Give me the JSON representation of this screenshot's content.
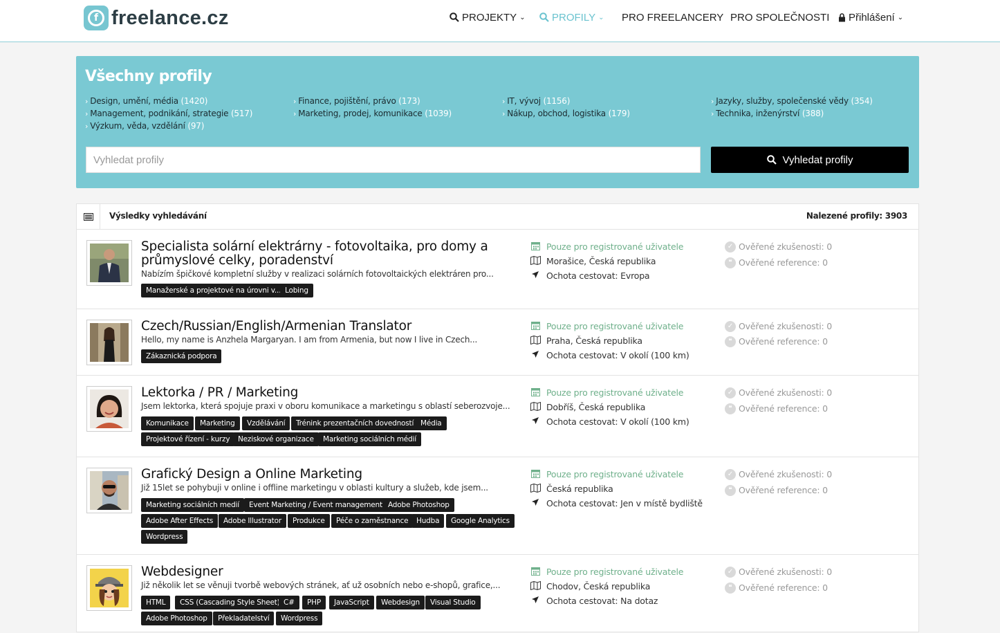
{
  "header": {
    "logo_text": "freelance.cz",
    "nav": [
      {
        "label": "PROJEKTY",
        "icon": "search-icon",
        "active": false
      },
      {
        "label": "PROFILY",
        "icon": "search-icon",
        "active": true
      },
      {
        "label": "PRO FREELANCERY"
      },
      {
        "label": "PRO SPOLEČNOSTI"
      },
      {
        "label": "Přihlášení",
        "icon": "lock-icon"
      }
    ],
    "accent_color": "#7ac9d3"
  },
  "hero": {
    "title": "Všechny profily",
    "categories": [
      {
        "label": "Design, umění, média",
        "count": "(1420)"
      },
      {
        "label": "Finance, pojištění, právo",
        "count": "(173)"
      },
      {
        "label": "IT, vývoj",
        "count": "(1156)"
      },
      {
        "label": "Jazyky, služby, společenské vědy",
        "count": "(354)"
      },
      {
        "label": "Management, podnikání, strategie",
        "count": "(517)"
      },
      {
        "label": "Marketing, prodej, komunikace",
        "count": "(1039)"
      },
      {
        "label": "Nákup, obchod, logistika",
        "count": "(179)"
      },
      {
        "label": "Technika, inženýrství",
        "count": "(388)"
      },
      {
        "label": "Výzkum, věda, vzdělání",
        "count": "(97)"
      }
    ],
    "search_placeholder": "Vyhledat profily",
    "search_button": "Vyhledat profily"
  },
  "results": {
    "title": "Výsledky vyhledávání",
    "count_label": "Nalezené profily: 3903",
    "profiles": [
      {
        "title": "Specialista solární elektrárny - fotovoltaika, pro domy a průmyslové celky, poradenství",
        "desc": "Nabízím špičkové kompletní služby v realizaci solárních fotovoltaických elektráren pro...",
        "tags": [
          "Manažerské a projektové na úrovni v...",
          "Lobing"
        ],
        "availability": "Pouze pro registrované uživatele",
        "location": "Morašice, Česká republika",
        "travel": "Ochota cestovat: Evropa",
        "verified_exp": "Ověřené zkušenosti: 0",
        "verified_ref": "Ověřené reference: 0"
      },
      {
        "title": "Czech/Russian/English/Armenian Translator",
        "desc": "Hello, my name is Anzhela Margaryan. I am from Armenia, but now I live in Czech...",
        "tags": [
          "Zákaznická podpora"
        ],
        "availability": "Pouze pro registrované uživatele",
        "location": "Praha, Česká republika",
        "travel": "Ochota cestovat: V okolí (100 km)",
        "verified_exp": "Ověřené zkušenosti: 0",
        "verified_ref": "Ověřené reference: 0"
      },
      {
        "title": "Lektorka / PR / Marketing",
        "desc": "Jsem lektorka, která spojuje praxi v oboru komunikace a marketingu s oblastí seberozvoje...",
        "tags": [
          "Komunikace",
          "Marketing",
          "Vzdělávání",
          "Trénink prezentačních dovedností",
          "Média",
          "Projektové řízení - kurzy",
          "Neziskové organizace",
          "Marketing sociálních médií"
        ],
        "availability": "Pouze pro registrované uživatele",
        "location": "Dobříš, Česká republika",
        "travel": "Ochota cestovat: V okolí (100 km)",
        "verified_exp": "Ověřené zkušenosti: 0",
        "verified_ref": "Ověřené reference: 0"
      },
      {
        "title": "Grafický Design a Online Marketing",
        "desc": "Již 15let se pohybuji v online i offline marketingu v oblasti kultury a služeb, kde jsem...",
        "tags": [
          "Marketing sociálních medií",
          "Event Marketing / Event management",
          "Adobe Photoshop",
          "Adobe After Effects",
          "Adobe Illustrator",
          "Produkce",
          "Péče o zaměstnance",
          "Hudba",
          "Google Analytics",
          "Wordpress"
        ],
        "availability": "Pouze pro registrované uživatele",
        "location": "Česká republika",
        "travel": "Ochota cestovat: Jen v místě bydliště",
        "verified_exp": "Ověřené zkušenosti: 0",
        "verified_ref": "Ověřené reference: 0"
      },
      {
        "title": "Webdesigner",
        "desc": "Již několik let se věnuji tvorbě webových stránek, ať už osobních nebo e-shopů, grafice,...",
        "tags": [
          "HTML",
          "CSS (Cascading Style Sheet)",
          "C#",
          "PHP",
          "JavaScript",
          "Webdesign",
          "Visual Studio",
          "Adobe Photoshop",
          "Překladatelství",
          "Wordpress"
        ],
        "availability": "Pouze pro registrované uživatele",
        "location": "Chodov, Česká republika",
        "travel": "Ochota cestovat: Na dotaz",
        "verified_exp": "Ověřené zkušenosti: 0",
        "verified_ref": "Ověřené reference: 0"
      }
    ]
  }
}
